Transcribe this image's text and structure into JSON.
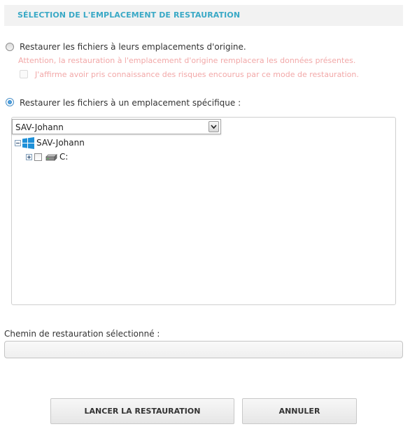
{
  "header": {
    "title": "SÉLECTION DE L'EMPLACEMENT DE RESTAURATION"
  },
  "options": {
    "original": {
      "label": "Restaurer les fichiers à leurs emplacements d'origine.",
      "selected": false,
      "warning": "Attention, la restauration à l'emplacement d'origine remplacera les données présentes.",
      "confirm_label": "J'affirme avoir pris connaissance des risques encourus par ce mode de restauration."
    },
    "specific": {
      "label": "Restaurer les fichiers à un emplacement spécifique :",
      "selected": true
    }
  },
  "machine_select": {
    "value": "SAV-Johann",
    "options": [
      "SAV-Johann"
    ]
  },
  "tree": {
    "root": {
      "label": "SAV-Johann",
      "icon": "windows-icon",
      "expanded": true
    },
    "children": [
      {
        "label": "C:",
        "icon": "hard-drive-icon",
        "expanded": false,
        "checked": false
      }
    ]
  },
  "restore_path": {
    "label": "Chemin de restauration sélectionné :",
    "value": ""
  },
  "buttons": {
    "launch": "LANCER LA RESTAURATION",
    "cancel": "ANNULER"
  },
  "colors": {
    "header_title": "#3aa9c6",
    "warning": "#f2a8a8",
    "windows_blue": "#1e90d8"
  }
}
